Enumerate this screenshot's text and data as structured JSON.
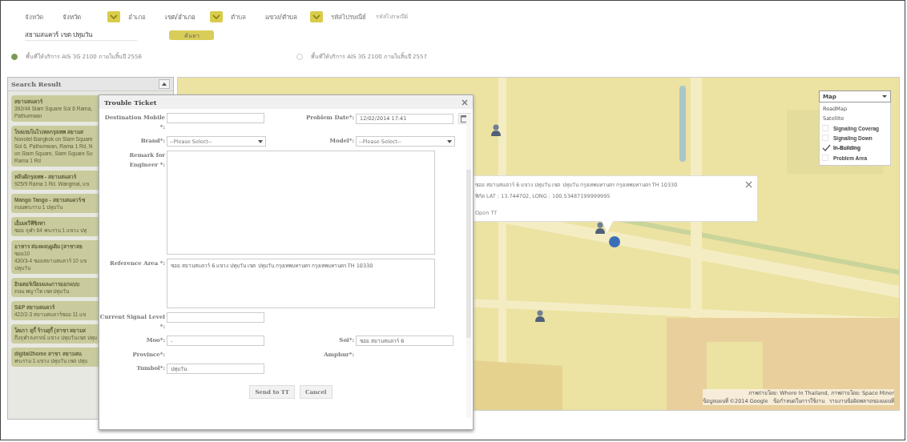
{
  "filters": [
    {
      "label": "จังหวัด",
      "value": "จังหวัด"
    },
    {
      "label": "อำเภอ",
      "value": "เขต/อำเภอ"
    },
    {
      "label": "ตำบล",
      "value": "แขวง/ตำบล"
    }
  ],
  "postcode": {
    "label": "รหัสไปรษณีย์",
    "placeholder": "รหัสไปรษณีย์"
  },
  "search": {
    "value": "สยามสแควร์ เขต ปทุมวัน",
    "button": "ค้นหา"
  },
  "coverage_options": [
    {
      "label": "พื้นที่ให้บริการ AIS 3G 2100 ภายในสิ้นปี 2556",
      "selected": true
    },
    {
      "label": "พื้นที่ให้บริการ AIS 3G 2100 ภายในสิ้นปี 2557",
      "selected": false
    }
  ],
  "search_result": {
    "title": "Search Result",
    "items": [
      {
        "name": "สยามสแควร์",
        "lines": [
          "392/44 Siam Square Soi 6 Rama,",
          "Pathumwan"
        ]
      },
      {
        "name": "โรงแรมโนโวเทลกรุงเทพ สยามส",
        "lines": [
          "Novotel Bangkok on Siam Square",
          "Soi 6, Pathumwan, Rama 1 Rd, N",
          "on Siam Square, Siam Square So",
          "Rama 1 Rd"
        ]
      },
      {
        "name": "หลีนดีกรุงเทพ - สยามสแควร์",
        "lines": [
          "925/9 Rama 1 Rd. Wangmai, แข"
        ]
      },
      {
        "name": "Mango Tango - สยามสแควร์ ซ",
        "lines": [
          "ถนนพระราม 1 ปทุมวัน"
        ]
      },
      {
        "name": "เอ็มเควีพีชิงหา",
        "lines": [
          "ซอย จุฬา 64 พระราม 1 แขวง ปทุ"
        ]
      },
      {
        "name": "อาหาร ส่องคงฤดูเดิม (สาขาสย",
        "lines": [
          "ซอย10",
          "430/3-4 ซอยสยามสแควร์ 10 แข",
          "ปทุมวัน"
        ]
      },
      {
        "name": "อินเตอร์เนียมและการออกแบบ",
        "lines": [
          "ถนน พญาไท เขต ปทุมวัน"
        ]
      },
      {
        "name": "S&P สยามสแควร์",
        "lines": [
          "422/2-3 สยามสแควร์ซอย 11 แข"
        ]
      },
      {
        "name": "โตเกา สุกี้ ร้านสุกี้ (สาขา สยามส",
        "lines": [
          "ถึงจุฬาลงกรณ์ แขวง ปทุมวัน เขต ปทุม"
        ]
      },
      {
        "name": "digital2home สาขา สยามสแ",
        "lines": [
          "พระราม 1 แขวง ปทุมวัน เขต ปทุม"
        ]
      }
    ]
  },
  "map": {
    "type_menu": {
      "value": "Map",
      "options": [
        "RoadMap",
        "Satellite"
      ],
      "layers": [
        {
          "label": "Signaling Coverag",
          "checked": false
        },
        {
          "label": "Signaling Down",
          "checked": false
        },
        {
          "label": "In-Building",
          "checked": true
        },
        {
          "label": "Problem Area",
          "checked": false
        }
      ]
    },
    "info_window": {
      "address": "ซอย สยามสแควร์ 6 แขวง ปทุมวัน เขต ปทุมวัน กรุงเทพมหานคร กรุงเทพมหานคร TH 10330",
      "coords": "พิกัด LAT : 13.744702, LONG : 100.53487199999995",
      "link": "Open TT"
    },
    "attribution": [
      "ภาพถ่ายโดย: Where In Thailand, ภาพถ่ายโดย: Space Miner",
      "ข้อมูลแผนที่ ©2014 Google   ข้อกำหนดในการใช้งาน   รายงานข้อผิดพลาดของแผนที่"
    ]
  },
  "dialog": {
    "title": "Trouble Ticket",
    "rows": [
      [
        {
          "kind": "input",
          "label": "Destination Mobile *:"
        },
        {
          "kind": "date",
          "label": "Problem Date*:",
          "value": "12/02/2014 17:41"
        }
      ],
      [
        {
          "kind": "select",
          "label": "Brand*:",
          "value": "--Please Select--"
        },
        {
          "kind": "select",
          "label": "Model*:",
          "value": "--Please Select--"
        }
      ],
      [
        {
          "kind": "textarea",
          "label": "Remark for Engineer *:"
        }
      ],
      [
        {
          "kind": "area",
          "label": "Reference Area *:",
          "value": "ซอย สยามสแควร์ 6 แขวง ปทุมวัน เขต ปทุมวัน กรุงเทพมหานคร กรุงเทพมหานคร TH 10330"
        }
      ],
      [
        {
          "kind": "input",
          "label": "Current Signal Level *:"
        }
      ],
      [
        {
          "kind": "input",
          "label": "Moo*:",
          "value": "-"
        },
        {
          "kind": "input",
          "label": "Soi*:",
          "value": "ซอย สยามสแควร์ 6"
        }
      ],
      [
        {
          "kind": "plain",
          "label": "Province*:"
        },
        {
          "kind": "plain",
          "label": "Amphur*:"
        }
      ],
      [
        {
          "kind": "input",
          "label": "Tumbol*:",
          "value": "ปทุมวัน"
        }
      ]
    ],
    "buttons": [
      "Send to TT",
      "Cancel"
    ]
  }
}
